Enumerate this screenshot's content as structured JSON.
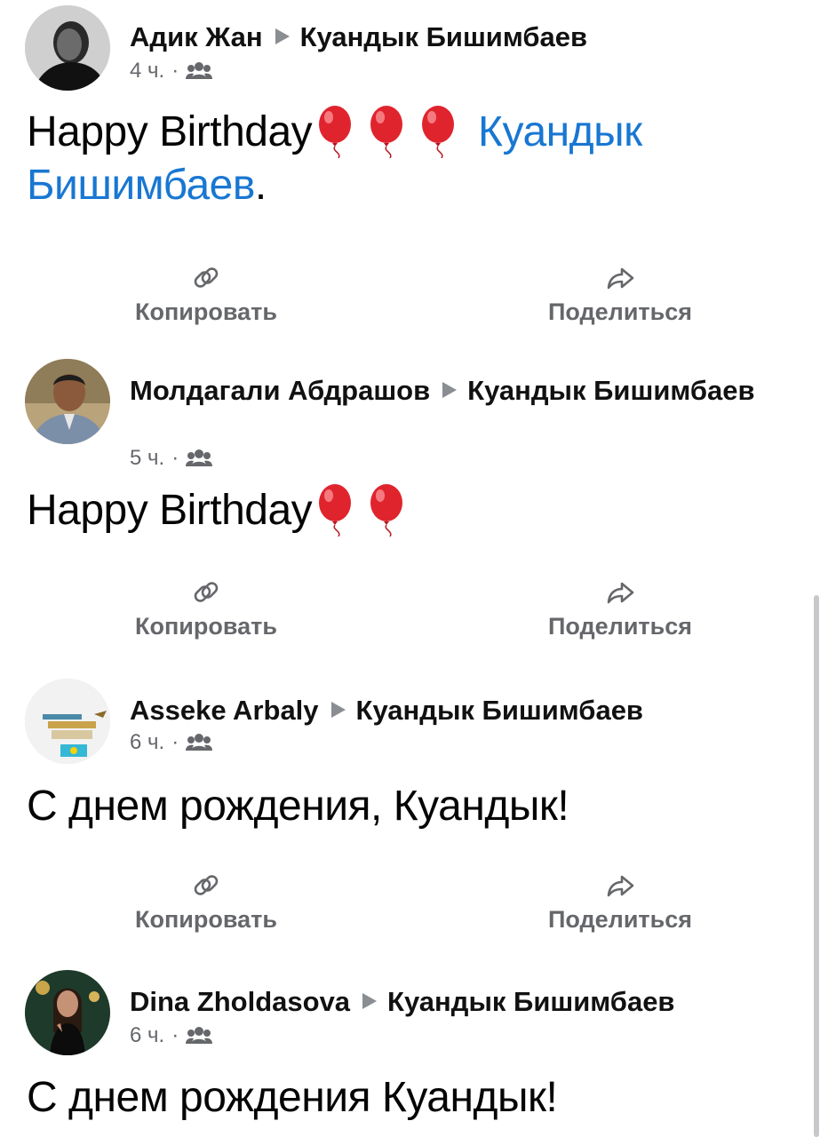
{
  "posts": [
    {
      "author": "Адик Жан",
      "target": "Куандык Бишимбаев",
      "time": "4 ч.",
      "separator": "·",
      "text_before": "Happy Birthday",
      "balloons": 3,
      "mention": "Куандык Бишимбаев",
      "text_after": ".",
      "avatar_icon": "person-photo-avatar",
      "audience_icon": "friends-icon"
    },
    {
      "author": "Молдагали Абдрашов",
      "target": "Куандык Бишимбаев",
      "time": "5 ч.",
      "separator": "·",
      "text_before": "Happy Birthday",
      "balloons": 2,
      "avatar_icon": "person-photo-avatar",
      "audience_icon": "friends-icon"
    },
    {
      "author": "Asseke Arbaly",
      "target": "Куандык Бишимбаев",
      "time": "6 ч.",
      "separator": "·",
      "text": "С днем рождения, Куандык!",
      "avatar_icon": "flag-photo-avatar",
      "audience_icon": "friends-icon"
    },
    {
      "author": "Dina Zholdasova",
      "target": "Куандык Бишимбаев",
      "time": "6 ч.",
      "separator": "·",
      "text": "С днем рождения Куандык!",
      "avatar_icon": "person-photo-avatar",
      "audience_icon": "friends-icon"
    }
  ],
  "actions": {
    "copy_label": "Копировать",
    "copy_icon": "link-icon",
    "share_label": "Поделиться",
    "share_icon": "share-arrow-icon"
  },
  "colors": {
    "mention": "#1877d2",
    "secondary_text": "#65676b",
    "balloon": "#e0242e"
  }
}
